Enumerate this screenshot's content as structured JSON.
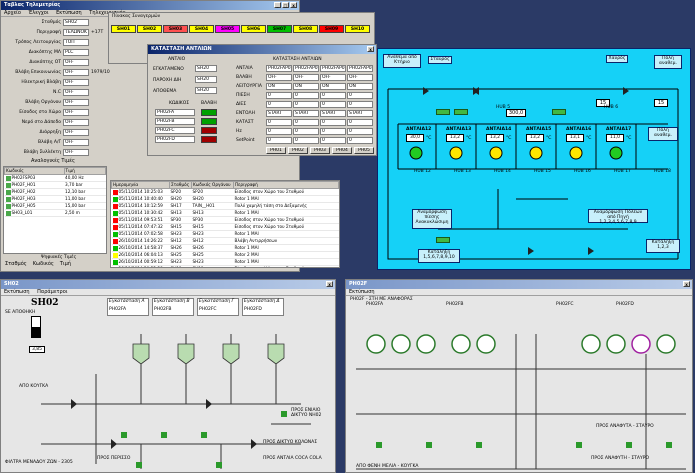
{
  "main_window": {
    "title": "Ταβλας Τηλεμετρίας",
    "menu": [
      "Αρχείο",
      "Έλεγχοι",
      "Εκτύπωση",
      "Τηλεχειρισμός"
    ],
    "fields": [
      {
        "label": "Σταθμός",
        "value": "SH02"
      },
      {
        "label": "Περιγραφή",
        "value": "ΤΕΛΩΝΟΚΤ",
        "extra": "+17T"
      },
      {
        "label": "Τρόπος Λειτουργίας",
        "value": "ΤΟΠ"
      },
      {
        "label": "Διακόπτης ΜΛ",
        "value": "PLC"
      },
      {
        "label": "Διακόπτης ΟΤ",
        "value": "OFF"
      },
      {
        "label": "Βλάβη Επικοινωνίας",
        "value": "OFF",
        "extra": "1979/10"
      },
      {
        "label": "Ηλεκτρική Βλάβη",
        "value": "OFF"
      },
      {
        "label": "N.C",
        "value": "OFF"
      },
      {
        "label": "Βλάβη Οργάνου",
        "value": "OFF"
      },
      {
        "label": "Είσοδος στο Χώρο",
        "value": "OFF"
      },
      {
        "label": "Νερό στο Δάπεδο",
        "value": "OFF"
      },
      {
        "label": "Διάρρηξη",
        "value": "OFF"
      },
      {
        "label": "Βλάβη Α/Γ",
        "value": "OFF"
      },
      {
        "label": "Βλάβη Συλλέκτη",
        "value": "OFF"
      }
    ],
    "analog_title": "Αναλογικές Τιμές",
    "analog_headers": [
      "Κωδικός",
      "Τιμή"
    ],
    "analog_rows": [
      {
        "code": "PH02FSP03",
        "value": "40,00 Hz",
        "color": "#4aa84a"
      },
      {
        "code": "PH02F_H01",
        "value": "3,70 bar",
        "color": "#4aa84a"
      },
      {
        "code": "PH02F_H02",
        "value": "12,10 bar",
        "color": "#4aa84a"
      },
      {
        "code": "PH02F_H03",
        "value": "11,00 bar",
        "color": "#4aa84a"
      },
      {
        "code": "PH02F_H05",
        "value": "15,00 bar",
        "color": "#4aa84a"
      },
      {
        "code": "SH03_L01",
        "value": "2,50 m",
        "color": "#4aa84a"
      }
    ],
    "digital_title": "Ψηφιακές Τιμές",
    "digital_headers": [
      "Σταθμός",
      "Κωδικός",
      "Τιμή"
    ]
  },
  "station_tabs": {
    "title": "Πίνακας Συναγερμών",
    "tabs": [
      {
        "label": "SH01",
        "color": "#ffff00"
      },
      {
        "label": "SH02",
        "color": "#ffff00"
      },
      {
        "label": "SH03",
        "color": "#ff5050"
      },
      {
        "label": "SH04",
        "color": "#ffff00"
      },
      {
        "label": "SH05",
        "color": "#ff00ff"
      },
      {
        "label": "SH06",
        "color": "#ffff00"
      },
      {
        "label": "SH07",
        "color": "#00c000"
      },
      {
        "label": "SH08",
        "color": "#ffff00"
      },
      {
        "label": "SH09",
        "color": "#ff0000"
      },
      {
        "label": "SH10",
        "color": "#ffff00"
      }
    ]
  },
  "pump_status": {
    "title": "ΚΑΤΑΣΤΑΣΗ ΑΝΤΛΙΩΝ",
    "left_header": "ΑΝΤΛΙΟ",
    "left_rows": [
      {
        "label": "ΕΓΚΑΤΑΜΕΝΟ",
        "value": "SH20"
      },
      {
        "label": "ΠΑΡΟΧΗ ΔΙΗ",
        "value": "SH20"
      },
      {
        "label": "ΑΠΟΘΕΜΑ",
        "value": "SH20"
      }
    ],
    "sub_headers": [
      "ΚΩΔΙΚΟΣ",
      "ΒΛΑΒΗ"
    ],
    "codes": [
      "PH02FA",
      "PH02FB",
      "PH02FC",
      "PH02FD"
    ],
    "right_header": "ΚΑΤΑΣΤΑΣΗ ΑΝΤΛΙΩΝ",
    "right_cols": [
      "PH02FAP01",
      "PH02FAP02",
      "PH02FAP03",
      "PH02FAP04"
    ],
    "right_row_labels": [
      "ΑΝΤΛΙΑ",
      "ΒΛΑΒΗ",
      "ΛΕΙΤΟΥΡΓΙΑ",
      "ΠΙΕΣΗ",
      "ΔΙΕΣ",
      "ΕΝΤΟΛΗ",
      "ΚΑΤΑΣΤ",
      "Hz",
      "SetPoint"
    ],
    "cell_values": {
      "on": "ON",
      "off": "OFF",
      "start": "START",
      "val": "0"
    },
    "buttons": [
      "PH01",
      "PH02",
      "PH03",
      "PH04",
      "PH05"
    ]
  },
  "alarm_log": {
    "headers": [
      "Ημερομηνία",
      "Σταθμός",
      "Κωδικός Οργάνου",
      "Περιγραφή"
    ],
    "rows": [
      {
        "date": "05/11/2014 10:25:03",
        "station": "SP20",
        "code": "SP20",
        "desc": "Είσοδος στον Χώρο του Σταθμού",
        "color": "#ff0000"
      },
      {
        "date": "05/11/2014 10:40:40",
        "station": "SH20",
        "code": "SH20",
        "desc": "Rotor 1 ΜΑΙ",
        "color": "#00c000"
      },
      {
        "date": "05/11/2014 10:12:59",
        "station": "SH17",
        "code": "TAIN__H01",
        "desc": "Πολύ χαμηλή τάση στο Δεξαμενής",
        "color": "#ff0000"
      },
      {
        "date": "05/11/2014 10:30:42",
        "station": "SH13",
        "code": "SH13",
        "desc": "Rotor 1 ΜΑΙ",
        "color": "#00c000"
      },
      {
        "date": "05/11/2014 09:53:51",
        "station": "SP30",
        "code": "SP30",
        "desc": "Είσοδος στον Χώρο του Σταθμού",
        "color": "#ff0000"
      },
      {
        "date": "05/11/2014 07:47:32",
        "station": "SH15",
        "code": "SH15",
        "desc": "Είσοδος στον Χώρο του Σταθμού",
        "color": "#ff0000"
      },
      {
        "date": "05/11/2014 07:02:58",
        "station": "SH23",
        "code": "SH23",
        "desc": "Rotor 1 ΜΑΙ",
        "color": "#00c000"
      },
      {
        "date": "26/10/2014 14:26:22",
        "station": "SH12",
        "code": "SH12",
        "desc": "Βλάβη Αντιρρήσεων",
        "color": "#ff0000"
      },
      {
        "date": "26/10/2014 14:58:37",
        "station": "SH26",
        "code": "SH26",
        "desc": "Rotor 1 ΜΑΙ",
        "color": "#00c000"
      },
      {
        "date": "26/10/2014 06:04:13",
        "station": "SH25",
        "code": "SH25",
        "desc": "Rotor 2 ΜΑΙ",
        "color": "#ffff00"
      },
      {
        "date": "26/10/2014 00:59:12",
        "station": "SH23",
        "code": "SH23",
        "desc": "Rotor 1 ΜΑΙ",
        "color": "#00c000"
      },
      {
        "date": "26/10/2014 20:22:28",
        "station": "SH11",
        "code": "SH11",
        "desc": "Είσοδος στον Χώρο του Σταθμού",
        "color": "#ff0000"
      },
      {
        "date": "26/10/2014 20:08:48",
        "station": "SH20",
        "code": "TK20__L01",
        "desc": "Βλάβη Οργάνου",
        "color": "#ffff00"
      },
      {
        "date": "26/10/2014 20:08:48",
        "station": "SH02",
        "code": "PH02FCP01",
        "desc": "Βλάβη Οργάνου",
        "color": "#ffff00"
      }
    ]
  },
  "cyan_diagram": {
    "top_labels": [
      "Ανάθεμα από Κτήριο",
      "Σταυρός",
      "Χαυρός",
      "Πόλη αναθεμ."
    ],
    "pumps": [
      {
        "name": "ΑΝΤΛΙΑ12",
        "value": "30,0",
        "unit": "°C"
      },
      {
        "name": "ΑΝΤΛΙΑ13",
        "value": "13,2",
        "unit": "°C"
      },
      {
        "name": "ΑΝΤΛΙΑ14",
        "value": "13,2",
        "unit": "°C"
      },
      {
        "name": "ΑΝΤΛΙΑ15",
        "value": "13,2",
        "unit": "°C"
      },
      {
        "name": "ΑΝΤΛΙΑ16",
        "value": "13,1",
        "unit": "°C"
      },
      {
        "name": "ΑΝΤΛΙΑ17",
        "value": "11,0",
        "unit": "°C"
      }
    ],
    "hub_labels": [
      "HUB 12",
      "HUB 13",
      "HUB 14",
      "HUB 15",
      "HUB 16",
      "HUB 17",
      "HUB 18",
      "HUB 5",
      "HUB 6"
    ],
    "top_values": {
      "left": "15",
      "mid": "300,0",
      "right": "15"
    },
    "bottom_left": "Αναμόρφωση πίεσης Ανακυκλώσιμη",
    "bottom_right": "Αναμόρφωση Πόλεων από Πηγή 1,2,3,4,5,6,7,8,9",
    "bottom_box": "Κατάληξη 1,5,6,7,8,9,10",
    "right_labels": [
      "Πόλη αναθεμ.",
      "Κατάληξη 1,2,3"
    ]
  },
  "sh02_window": {
    "title": "SH02",
    "menu": [
      "Εκτύπωση",
      "Παράμετροι"
    ],
    "station_label": "SH02",
    "field_label": "SE ΑΠΟΘΗΚΗ",
    "panels": [
      "Εγκατάσταση Α",
      "Εγκατάσταση Β",
      "Εγκατάσταση Γ",
      "Εγκατάσταση Δ"
    ],
    "panel_codes": [
      "PH02FA",
      "PH02FB",
      "PH02FC",
      "PH02FD"
    ],
    "level_value": "3,85",
    "labels": {
      "left_bottom": "ΑΠΟ ΚΟΥΓΚΑ",
      "bottom_left": "ΦΙΛΤΡΑ ΜΕΝΑΔΟΥ ΖΩΝ - 2305",
      "bottom_mid": "ΠΡΟΣ ΠΕΡΙΣΣΟ",
      "bottom_right": "ΠΡΟΣ ΑΝΤΛΙΑ COCA COLA",
      "right_mid": "ΠΡΟΣ ΕΝΙΑΙΟ ΔΙΚΤΥΟ ΝΗ02",
      "right_low": "ΠΡΟΣ ΔΙΚΤΥΟ ΚΟΛΩΝΑΣ"
    }
  },
  "ph02f_window": {
    "title": "PH02F",
    "menu": [
      "Εκτύπωση"
    ],
    "header": "PH02F - ΣΤΗ ΜΕ ΑΝΑΦΟΡΑΣ",
    "group_labels": [
      "PH02FA",
      "PH02FB",
      "PH02FC",
      "PH02FD"
    ],
    "labels": {
      "bottom_left": "ΑΠΟ ΦΕΝΗ ΜΕΛΙΑ - ΚΟΥΓΚΑ",
      "bottom_right": "ΠΡΟΣ ΑΝΑΦΥΤΗ - ΣΤΑΥΡΟ",
      "right": "ΠΡΟΣ ΑΝΑΦΥΤΑ - ΣΤΑΥΡΟ"
    }
  }
}
